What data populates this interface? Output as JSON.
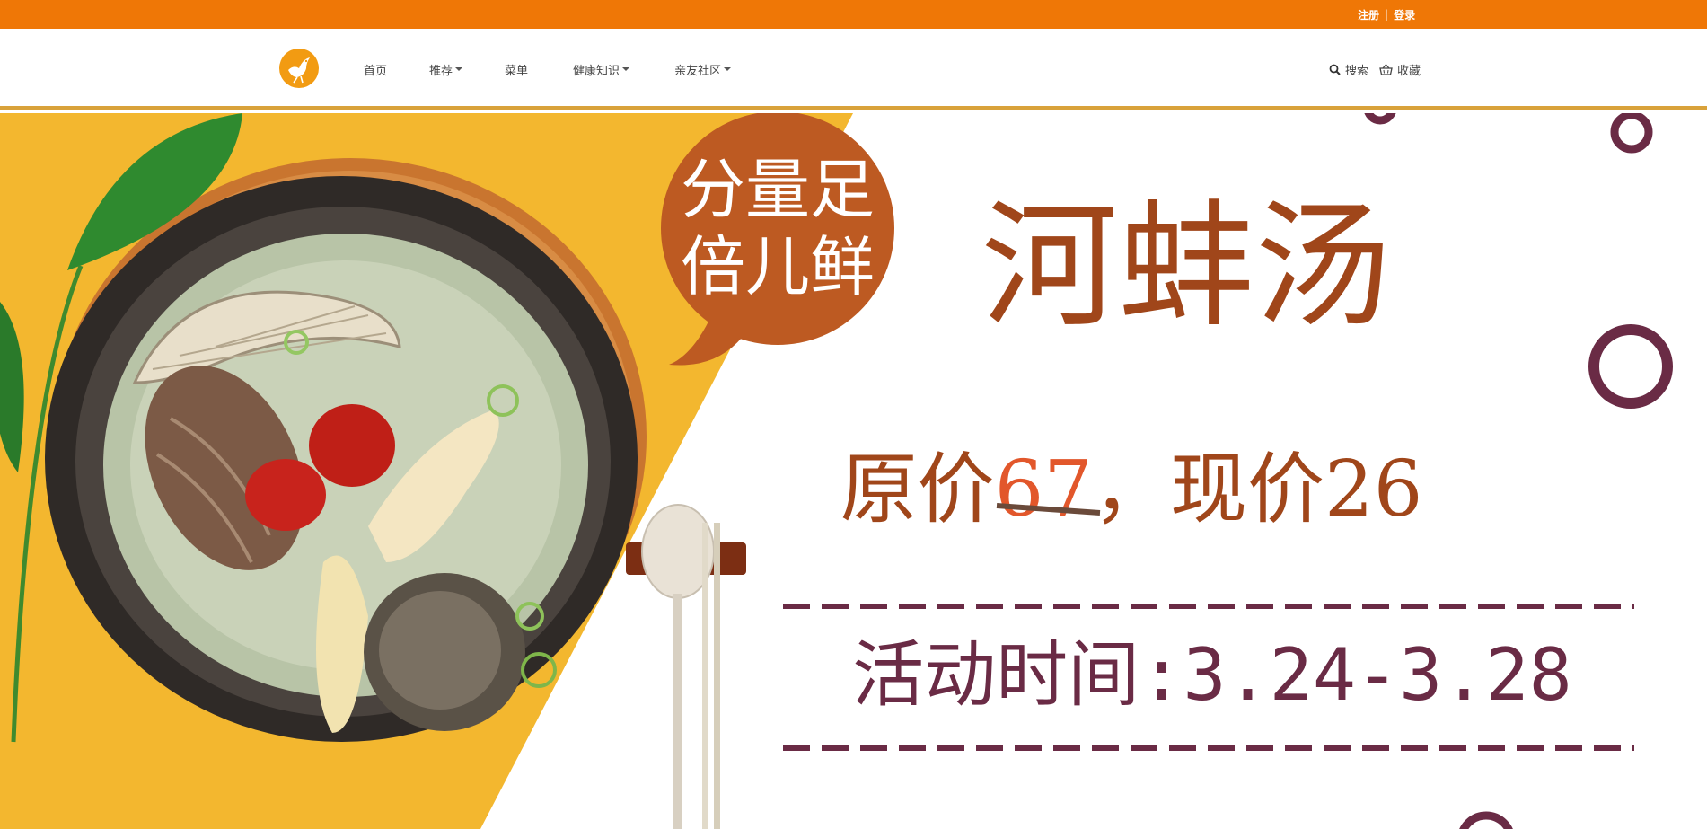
{
  "topbar": {
    "register": "注册",
    "separator": "|",
    "login": "登录"
  },
  "nav": {
    "items": [
      {
        "label": "首页",
        "dropdown": false
      },
      {
        "label": "推荐",
        "dropdown": true
      },
      {
        "label": "菜单",
        "dropdown": false
      },
      {
        "label": "健康知识",
        "dropdown": true
      },
      {
        "label": "亲友社区",
        "dropdown": true
      }
    ],
    "search_label": "搜索",
    "favorites_label": "收藏"
  },
  "banner": {
    "bubble_line1": "分量足",
    "bubble_line2": "倍儿鲜",
    "title": "河蚌汤",
    "price_prefix": "原价",
    "original_price": "67",
    "price_middle": "，现价",
    "current_price": "26",
    "event_time": "活动时间:3.24-3.28"
  },
  "colors": {
    "topbar": "#ef7706",
    "banner_yellow": "#f3b72f",
    "title_brown": "#a0461a",
    "bubble": "#bd5a22",
    "price_red": "#e2572b",
    "plum": "#6a2b45"
  }
}
